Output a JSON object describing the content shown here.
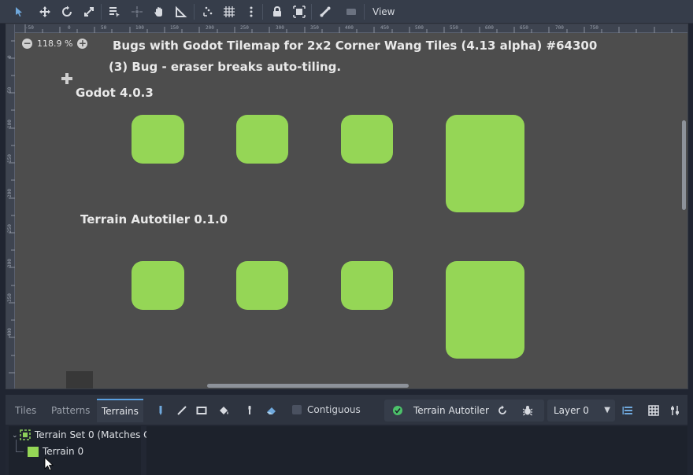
{
  "toolbar": {
    "tools": [
      {
        "name": "select-tool",
        "icon": "cursor-arrow-icon"
      },
      {
        "name": "move-tool",
        "icon": "move-arrows-icon"
      },
      {
        "name": "rotate-tool",
        "icon": "rotate-icon"
      },
      {
        "name": "scale-tool",
        "icon": "scale-icon"
      },
      {
        "name": "list-select-tool",
        "icon": "list-select-icon"
      },
      {
        "name": "pivot-tool",
        "icon": "pivot-icon"
      },
      {
        "name": "pan-tool",
        "icon": "hand-icon"
      },
      {
        "name": "ruler-tool",
        "icon": "ruler-icon"
      },
      {
        "name": "smart-snap",
        "icon": "smart-snap-icon"
      },
      {
        "name": "grid-snap",
        "icon": "grid-snap-icon"
      },
      {
        "name": "snap-options",
        "icon": "kebab-menu-icon"
      },
      {
        "name": "lock",
        "icon": "lock-icon"
      },
      {
        "name": "group",
        "icon": "group-icon"
      },
      {
        "name": "bones",
        "icon": "bone-icon"
      },
      {
        "name": "camera-override",
        "icon": "camera-icon"
      }
    ],
    "view_label": "View"
  },
  "viewport": {
    "zoom": "118.9 %",
    "ruler_top_ticks": [
      "-50",
      "0",
      "50",
      "100",
      "150",
      "200",
      "250",
      "300",
      "350",
      "400",
      "450",
      "500",
      "550",
      "600",
      "650",
      "700",
      "750"
    ],
    "ruler_left_ticks": [
      "0",
      "50",
      "100",
      "150",
      "200",
      "250",
      "300",
      "350",
      "400"
    ],
    "title": "Bugs with Godot Tilemap for 2x2 Corner Wang Tiles (4.13 alpha) #64300",
    "subtitle": "(3) Bug - eraser breaks auto-tiling.",
    "section1_label": "Godot 4.0.3",
    "section2_label": "Terrain Autotiler 0.1.0",
    "tile_color": "#95d656"
  },
  "bottom_panel": {
    "tabs": [
      {
        "label": "Tiles",
        "active": false
      },
      {
        "label": "Patterns",
        "active": false
      },
      {
        "label": "Terrains",
        "active": true
      }
    ],
    "tools": [
      {
        "name": "paint-tool",
        "icon": "pencil-icon"
      },
      {
        "name": "line-tool",
        "icon": "line-icon"
      },
      {
        "name": "rect-tool",
        "icon": "rectangle-icon"
      },
      {
        "name": "bucket-tool",
        "icon": "bucket-icon"
      },
      {
        "name": "picker-tool",
        "icon": "eyedropper-icon"
      },
      {
        "name": "eraser-tool",
        "icon": "eraser-icon"
      }
    ],
    "contiguous_label": "Contiguous",
    "contiguous_checked": false,
    "plugin": {
      "label": "Terrain Autotiler",
      "status_icon": "check-circle-icon",
      "reload_icon": "reload-icon",
      "debug_icon": "bug-icon"
    },
    "layer_select": {
      "value": "Layer 0"
    },
    "right_tools": [
      {
        "name": "layer-highlight",
        "icon": "layers-list-icon"
      },
      {
        "name": "grid-toggle",
        "icon": "grid-icon"
      },
      {
        "name": "tile-settings",
        "icon": "settings-tune-icon"
      }
    ],
    "tree": {
      "terrain_set": "Terrain Set 0 (Matches C",
      "terrain": "Terrain 0"
    }
  }
}
